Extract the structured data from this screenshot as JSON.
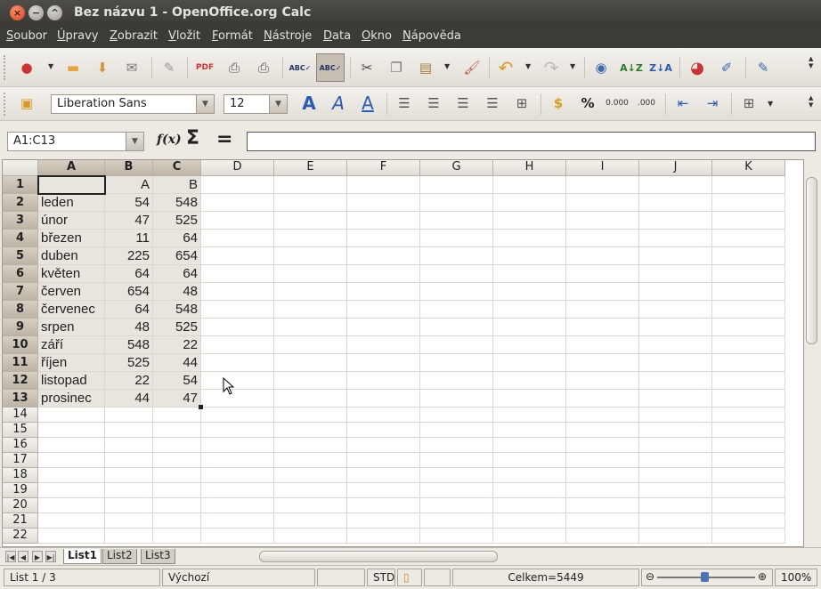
{
  "window": {
    "title": "Bez názvu 1 - OpenOffice.org Calc"
  },
  "menu": [
    "Soubor",
    "Úpravy",
    "Zobrazit",
    "Vložit",
    "Formát",
    "Nástroje",
    "Data",
    "Okno",
    "Nápověda"
  ],
  "toolbar2": {
    "font_name": "Liberation Sans",
    "font_size": "12"
  },
  "formula_bar": {
    "name_box": "A1:C13",
    "formula": ""
  },
  "columns": [
    "A",
    "B",
    "C",
    "D",
    "E",
    "F",
    "G",
    "H",
    "I",
    "J",
    "K"
  ],
  "rows": [
    "1",
    "2",
    "3",
    "4",
    "5",
    "6",
    "7",
    "8",
    "9",
    "10",
    "11",
    "12",
    "13",
    "14",
    "15",
    "16",
    "17",
    "18",
    "19",
    "20",
    "21",
    "22"
  ],
  "cells": [
    [
      "",
      "A",
      "B"
    ],
    [
      "leden",
      "54",
      "548"
    ],
    [
      "únor",
      "47",
      "525"
    ],
    [
      "březen",
      "11",
      "64"
    ],
    [
      "duben",
      "225",
      "654"
    ],
    [
      "květen",
      "64",
      "64"
    ],
    [
      "červen",
      "654",
      "48"
    ],
    [
      "červenec",
      "64",
      "548"
    ],
    [
      "srpen",
      "48",
      "525"
    ],
    [
      "září",
      "548",
      "22"
    ],
    [
      "říjen",
      "525",
      "44"
    ],
    [
      "listopad",
      "22",
      "54"
    ],
    [
      "prosinec",
      "44",
      "47"
    ]
  ],
  "sheet_tabs": [
    "List1",
    "List2",
    "List3"
  ],
  "status": {
    "sheet": "List 1 / 3",
    "style": "Výchozí",
    "mode": "STD",
    "sum": "Celkem=5449",
    "zoom": "100%"
  },
  "icons": [
    "open-icon",
    "save-icon",
    "print-icon",
    "spellcheck-icon",
    "cut-icon",
    "copy-icon",
    "paste-icon",
    "undo-icon",
    "redo-icon",
    "sort-icon",
    "chart-icon",
    "bold-icon",
    "italic-icon",
    "underline-icon",
    "align-left-icon",
    "percent-icon",
    "border-icon"
  ]
}
